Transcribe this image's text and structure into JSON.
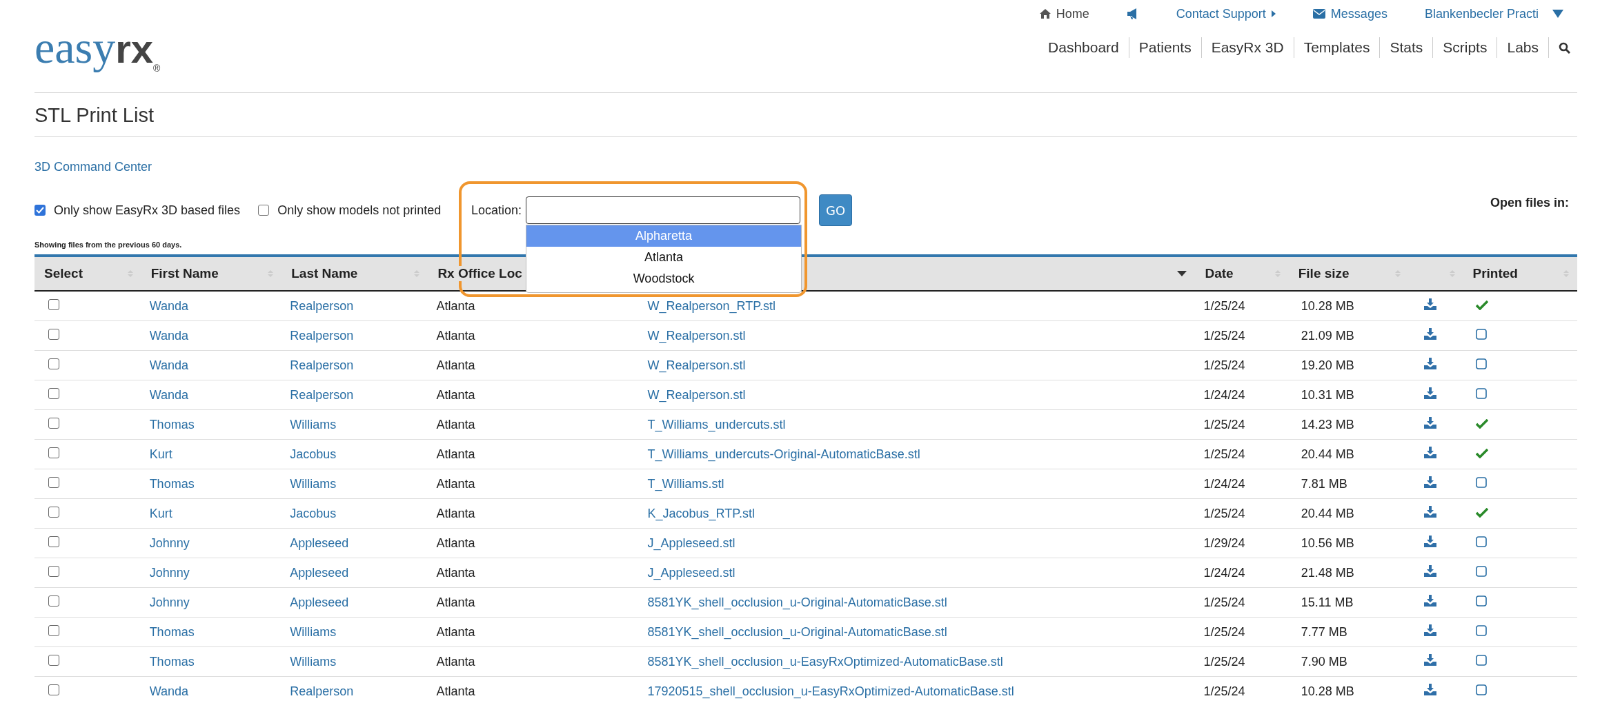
{
  "logo": {
    "text_main": "easy",
    "text_accent": "rx",
    "mark": "®"
  },
  "top_links": [
    {
      "kind": "home",
      "label": "Home"
    },
    {
      "kind": "announce"
    },
    {
      "kind": "support",
      "label": "Contact Support"
    },
    {
      "kind": "messages",
      "label": "Messages"
    },
    {
      "kind": "account",
      "label": "Blankenbecler Practi"
    }
  ],
  "nav": [
    "Dashboard",
    "Patients",
    "EasyRx 3D",
    "Templates",
    "Stats",
    "Scripts",
    "Labs"
  ],
  "page_title": "STL Print List",
  "command_link": "3D Command Center",
  "filters": [
    {
      "label": "Only show EasyRx 3D based files",
      "checked": true
    },
    {
      "label": "Only show models not printed",
      "checked": false
    }
  ],
  "location": {
    "label": "Location:",
    "options": [
      {
        "label": "Alpharetta",
        "selected": true
      },
      {
        "label": "Atlanta",
        "selected": false
      },
      {
        "label": "Woodstock",
        "selected": false
      }
    ]
  },
  "go_button": "GO",
  "open_files_label": "Open files in:",
  "note": "Showing files from the previous 60 days.",
  "table": {
    "columns": [
      {
        "label": "Select",
        "sorted": false
      },
      {
        "label": "First Name",
        "sorted": false
      },
      {
        "label": "Last Name",
        "sorted": false
      },
      {
        "label": "Rx Office Loc"
      },
      {
        "sorted": true
      },
      {
        "label": "Date",
        "sorted": false
      },
      {
        "label": "File size",
        "sorted": false
      },
      {
        "sorted": false
      },
      {
        "label": "Printed",
        "sorted": false
      }
    ],
    "rows": [
      {
        "selected": false,
        "first": "Wanda",
        "last": "Realperson",
        "location": "Atlanta",
        "file": "W_Realperson_RTP.stl",
        "date": "1/25/24",
        "size": "10.28 MB",
        "printed": true
      },
      {
        "selected": false,
        "first": "Wanda",
        "last": "Realperson",
        "location": "Atlanta",
        "file": "W_Realperson.stl",
        "date": "1/25/24",
        "size": "21.09 MB",
        "printed": false
      },
      {
        "selected": false,
        "first": "Wanda",
        "last": "Realperson",
        "location": "Atlanta",
        "file": "W_Realperson.stl",
        "date": "1/25/24",
        "size": "19.20 MB",
        "printed": false
      },
      {
        "selected": false,
        "first": "Wanda",
        "last": "Realperson",
        "location": "Atlanta",
        "file": "W_Realperson.stl",
        "date": "1/24/24",
        "size": "10.31 MB",
        "printed": false
      },
      {
        "selected": false,
        "first": "Thomas",
        "last": "Williams",
        "location": "Atlanta",
        "file": "T_Williams_undercuts.stl",
        "date": "1/25/24",
        "size": "14.23 MB",
        "printed": true
      },
      {
        "selected": false,
        "first": "Kurt",
        "last": "Jacobus",
        "location": "Atlanta",
        "file": "T_Williams_undercuts-Original-AutomaticBase.stl",
        "date": "1/25/24",
        "size": "20.44 MB",
        "printed": true
      },
      {
        "selected": false,
        "first": "Thomas",
        "last": "Williams",
        "location": "Atlanta",
        "file": "T_Williams.stl",
        "date": "1/24/24",
        "size": "7.81 MB",
        "printed": false
      },
      {
        "selected": false,
        "first": "Kurt",
        "last": "Jacobus",
        "location": "Atlanta",
        "file": "K_Jacobus_RTP.stl",
        "date": "1/25/24",
        "size": "20.44 MB",
        "printed": true
      },
      {
        "selected": false,
        "first": "Johnny",
        "last": "Appleseed",
        "location": "Atlanta",
        "file": "J_Appleseed.stl",
        "date": "1/29/24",
        "size": "10.56 MB",
        "printed": false
      },
      {
        "selected": false,
        "first": "Johnny",
        "last": "Appleseed",
        "location": "Atlanta",
        "file": "J_Appleseed.stl",
        "date": "1/24/24",
        "size": "21.48 MB",
        "printed": false
      },
      {
        "selected": false,
        "first": "Johnny",
        "last": "Appleseed",
        "location": "Atlanta",
        "file": "8581YK_shell_occlusion_u-Original-AutomaticBase.stl",
        "date": "1/25/24",
        "size": "15.11 MB",
        "printed": false
      },
      {
        "selected": false,
        "first": "Thomas",
        "last": "Williams",
        "location": "Atlanta",
        "file": "8581YK_shell_occlusion_u-Original-AutomaticBase.stl",
        "date": "1/25/24",
        "size": "7.77 MB",
        "printed": false
      },
      {
        "selected": false,
        "first": "Thomas",
        "last": "Williams",
        "location": "Atlanta",
        "file": "8581YK_shell_occlusion_u-EasyRxOptimized-AutomaticBase.stl",
        "date": "1/25/24",
        "size": "7.90 MB",
        "printed": false
      },
      {
        "selected": false,
        "first": "Wanda",
        "last": "Realperson",
        "location": "Atlanta",
        "file": "17920515_shell_occlusion_u-EasyRxOptimized-AutomaticBase.stl",
        "date": "1/25/24",
        "size": "10.28 MB",
        "printed": false
      }
    ]
  }
}
